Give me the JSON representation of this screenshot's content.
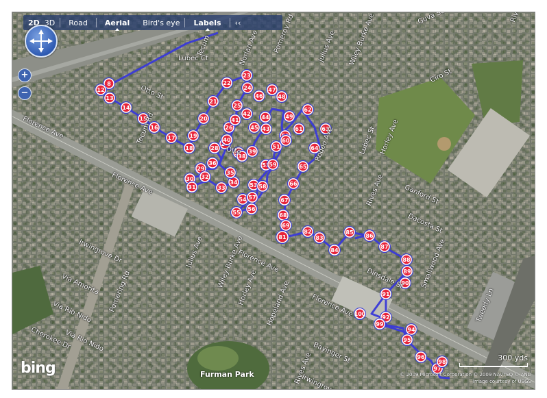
{
  "toolbar": {
    "items": [
      {
        "label": "2D",
        "bold": true,
        "active": true
      },
      {
        "label": "3D",
        "bold": false
      },
      {
        "label": "Road",
        "bold": false
      },
      {
        "label": "Aerial",
        "bold": true,
        "active": true
      },
      {
        "label": "Bird's eye",
        "bold": false
      },
      {
        "label": "Labels",
        "bold": true,
        "active": true
      },
      {
        "label": "‹‹",
        "bold": false
      }
    ]
  },
  "zoom": {
    "in_label": "+",
    "out_label": "−"
  },
  "logo": "bing",
  "scale": {
    "label": "300 yds"
  },
  "copyright": {
    "line1": "© 2009 Microsoft Corporation   © 2009 NAVTEQ   © AND",
    "line2": "Image courtesy of USGS"
  },
  "park": "Furman Park",
  "streets": [
    {
      "text": "Tecum",
      "angle": -68
    },
    {
      "text": "Lubec Ct"
    },
    {
      "text": "Norlan Ave",
      "angle": -68
    },
    {
      "text": "Pomeroy Rd",
      "angle": -68
    },
    {
      "text": "Julius Ave",
      "angle": -68
    },
    {
      "text": "Wiley Burke Ave",
      "angle": -68
    },
    {
      "text": "Guva St",
      "angle": -25
    },
    {
      "text": "Rives",
      "angle": -68
    },
    {
      "text": "Otto St",
      "angle": 25
    },
    {
      "text": "Ciro St",
      "angle": -25
    },
    {
      "text": "Florence Ave",
      "angle": 25
    },
    {
      "text": "Tecum Rd",
      "angle": -68
    },
    {
      "text": "Otto",
      "angle": 10
    },
    {
      "text": "Florence Ave",
      "angle": 25
    },
    {
      "text": "Rodeo Ave",
      "angle": -68
    },
    {
      "text": "Lubec St",
      "angle": -68
    },
    {
      "text": "Horley Ave",
      "angle": -68
    },
    {
      "text": "Ganford St",
      "angle": 25
    },
    {
      "text": "Rives Ave",
      "angle": -68
    },
    {
      "text": "Dacosta St",
      "angle": 25
    },
    {
      "text": "Irwingrove Dr",
      "angle": 25
    },
    {
      "text": "Julius Ave",
      "angle": -68
    },
    {
      "text": "Wiley Burke Ave",
      "angle": -68
    },
    {
      "text": "Florence Ave",
      "angle": 25
    },
    {
      "text": "Dinsdale St",
      "angle": 25
    },
    {
      "text": "Smallwood Ave",
      "angle": -68
    },
    {
      "text": "Via Amorita",
      "angle": 25
    },
    {
      "text": "Pomering Rd",
      "angle": -68
    },
    {
      "text": "Horley Ave",
      "angle": -68
    },
    {
      "text": "Florence Ave",
      "angle": 25
    },
    {
      "text": "Tweedy Ln",
      "angle": -68
    },
    {
      "text": "Via Rio Nido",
      "angle": 25
    },
    {
      "text": "Via Rio Nido",
      "angle": 25
    },
    {
      "text": "Hopeland Ave",
      "angle": -68
    },
    {
      "text": "Cherokee Dr",
      "angle": 25
    },
    {
      "text": "Bayinger St",
      "angle": 25
    },
    {
      "text": "Irwingrove Dr",
      "angle": 25
    },
    {
      "text": "Rives Ave",
      "angle": -68
    }
  ],
  "markers": [
    "8",
    "12",
    "13",
    "14",
    "15",
    "16",
    "17",
    "18",
    "19",
    "20",
    "21",
    "22",
    "23",
    "24",
    "25",
    "26",
    "27",
    "28",
    "29",
    "30",
    "31",
    "32",
    "33",
    "34",
    "35",
    "36",
    "37",
    "38",
    "39",
    "40",
    "41",
    "42",
    "43",
    "44",
    "45",
    "46",
    "47",
    "48",
    "49",
    "50",
    "51",
    "52",
    "53",
    "54",
    "55",
    "56",
    "57",
    "58",
    "59",
    "60",
    "61",
    "62",
    "63",
    "64",
    "65",
    "66",
    "67",
    "68",
    "69",
    "81",
    "82",
    "83",
    "84",
    "85",
    "86",
    "87",
    "88",
    "89",
    "90",
    "91",
    "92",
    "94",
    "95",
    "96",
    "97",
    "98",
    "99",
    "100"
  ],
  "colors": {
    "route": "#3a3ad8",
    "marker_fill": "#e8243a",
    "marker_stroke": "#ffffff",
    "toolbar": "#283e6e"
  }
}
